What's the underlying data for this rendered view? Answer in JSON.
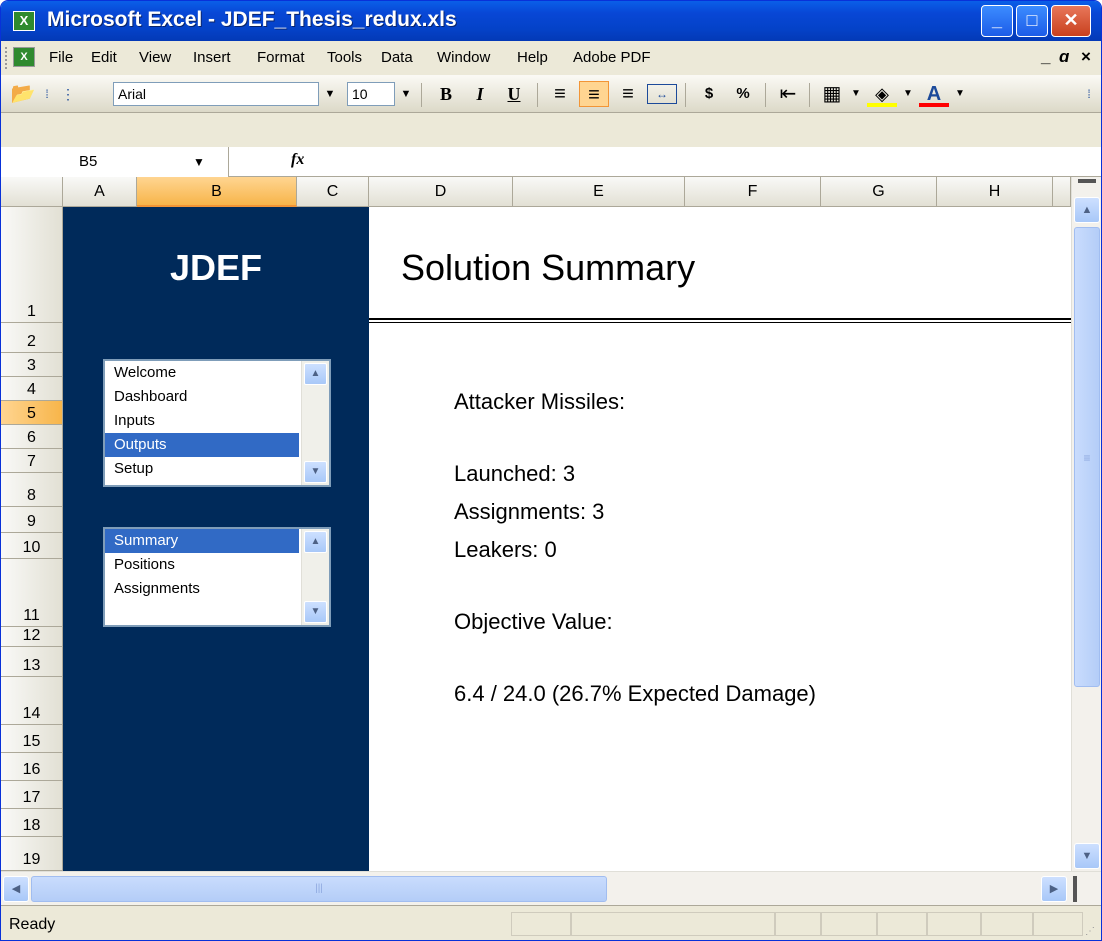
{
  "window": {
    "title": "Microsoft Excel - JDEF_Thesis_redux.xls",
    "minimize_icon": "minimize-icon",
    "maximize_icon": "maximize-icon",
    "close_icon": "close-icon"
  },
  "menubar": {
    "items": [
      "File",
      "Edit",
      "View",
      "Insert",
      "Format",
      "Tools",
      "Data",
      "Window",
      "Help",
      "Adobe PDF"
    ]
  },
  "toolbar": {
    "font_name": "Arial",
    "font_size": "10",
    "bold": "B",
    "italic": "I",
    "underline": "U",
    "currency": "$",
    "percent": "%",
    "accent_color": "#ffd591"
  },
  "formula_bar": {
    "name_box": "B5",
    "fx_label": "fx",
    "formula": ""
  },
  "grid": {
    "columns": [
      "A",
      "B",
      "C",
      "D",
      "E",
      "F",
      "G",
      "H"
    ],
    "rows": [
      "1",
      "2",
      "3",
      "4",
      "5",
      "6",
      "7",
      "8",
      "9",
      "10",
      "11",
      "12",
      "13",
      "14",
      "15",
      "16",
      "17",
      "18",
      "19"
    ],
    "selected_cell": "B5"
  },
  "nav": {
    "brand": "JDEF",
    "panel_color": "#002a5a",
    "main_list": {
      "items": [
        "Welcome",
        "Dashboard",
        "Inputs",
        "Outputs",
        "Setup"
      ],
      "selected": "Outputs"
    },
    "sub_list": {
      "items": [
        "Summary",
        "Positions",
        "Assignments"
      ],
      "selected": "Summary"
    }
  },
  "content": {
    "heading": "Solution Summary",
    "attacker_label": "Attacker Missiles:",
    "launched": "Launched: 3",
    "assignments": "Assignments: 3",
    "leakers": "Leakers: 0",
    "objective_label": "Objective Value:",
    "objective_value": "6.4 / 24.0  (26.7% Expected Damage)"
  },
  "status": {
    "text": "Ready"
  }
}
